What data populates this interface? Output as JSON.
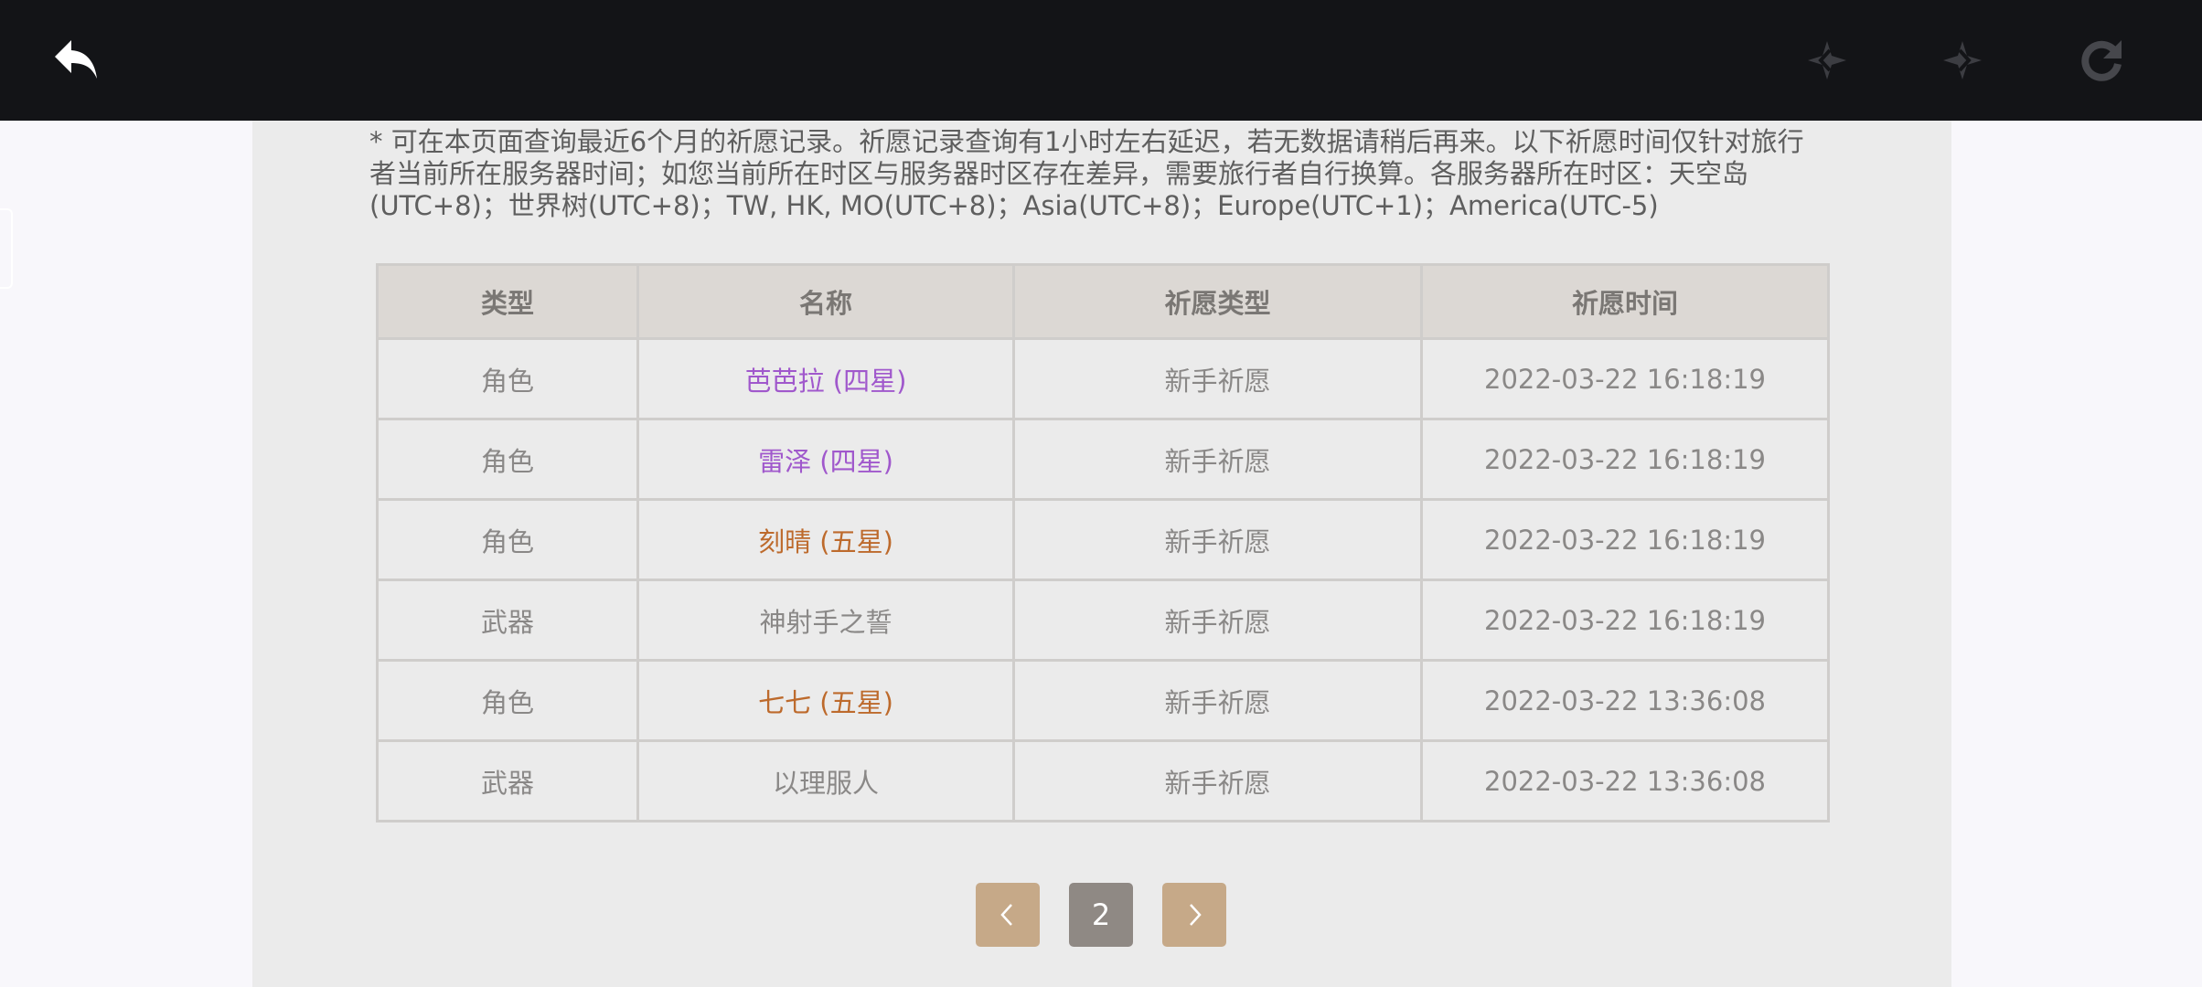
{
  "notice": "* 可在本页面查询最近6个月的祈愿记录。祈愿记录查询有1小时左右延迟，若无数据请稍后再来。以下祈愿时间仅针对旅行者当前所在服务器时间；如您当前所在时区与服务器时区存在差异，需要旅行者自行换算。各服务器所在时区：天空岛(UTC+8)；世界树(UTC+8)；TW, HK, MO(UTC+8)；Asia(UTC+8)；Europe(UTC+1)；America(UTC-5)",
  "table": {
    "headers": [
      "类型",
      "名称",
      "祈愿类型",
      "祈愿时间"
    ],
    "rows": [
      {
        "type": "角色",
        "name": "芭芭拉 (四星)",
        "wish_type": "新手祈愿",
        "time": "2022-03-22 16:18:19",
        "rarity": "four"
      },
      {
        "type": "角色",
        "name": "雷泽 (四星)",
        "wish_type": "新手祈愿",
        "time": "2022-03-22 16:18:19",
        "rarity": "four"
      },
      {
        "type": "角色",
        "name": "刻晴 (五星)",
        "wish_type": "新手祈愿",
        "time": "2022-03-22 16:18:19",
        "rarity": "five"
      },
      {
        "type": "武器",
        "name": "神射手之誓",
        "wish_type": "新手祈愿",
        "time": "2022-03-22 16:18:19",
        "rarity": "three"
      },
      {
        "type": "角色",
        "name": "七七 (五星)",
        "wish_type": "新手祈愿",
        "time": "2022-03-22 13:36:08",
        "rarity": "five"
      },
      {
        "type": "武器",
        "name": "以理服人",
        "wish_type": "新手祈愿",
        "time": "2022-03-22 13:36:08",
        "rarity": "three"
      }
    ]
  },
  "pagination": {
    "prev_icon": "chevron-left-icon",
    "current_page": "2",
    "next_icon": "chevron-right-icon"
  },
  "toolbar": {
    "back_icon": "back-arrow-icon",
    "nav_back_icon": "diamond-back-icon",
    "nav_forward_icon": "diamond-forward-icon",
    "refresh_icon": "refresh-icon"
  },
  "colors": {
    "four_star": "#a058cc",
    "five_star": "#bd6a2c",
    "pager_button": "#c6a988",
    "pager_current": "#8f8984"
  }
}
